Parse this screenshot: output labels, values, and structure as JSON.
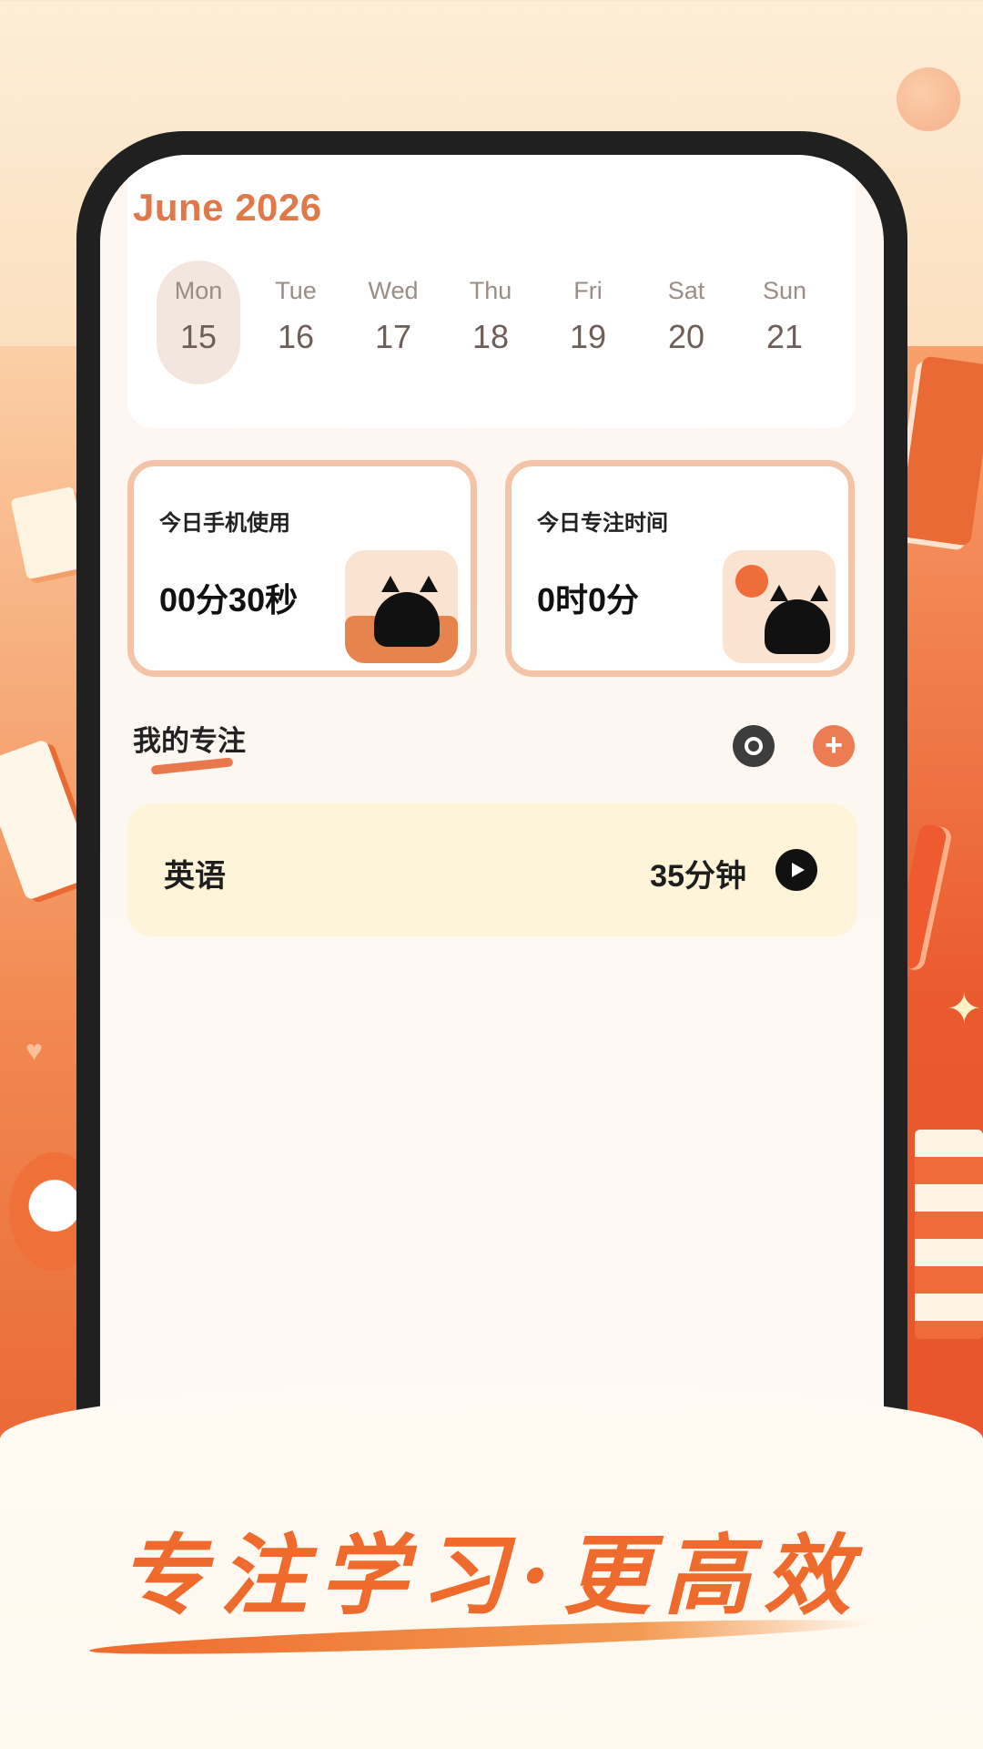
{
  "calendar": {
    "month_label": "June 2026",
    "days": [
      {
        "name": "Mon",
        "date": "15",
        "selected": true
      },
      {
        "name": "Tue",
        "date": "16"
      },
      {
        "name": "Wed",
        "date": "17"
      },
      {
        "name": "Thu",
        "date": "18"
      },
      {
        "name": "Fri",
        "date": "19"
      },
      {
        "name": "Sat",
        "date": "20"
      },
      {
        "name": "Sun",
        "date": "21"
      }
    ]
  },
  "stats": {
    "phone_usage": {
      "title": "今日手机使用",
      "value": "00分30秒"
    },
    "focus_time": {
      "title": "今日专注时间",
      "value": "0时0分"
    }
  },
  "my_focus": {
    "title": "我的专注",
    "items": [
      {
        "name": "英语",
        "duration": "35分钟"
      }
    ]
  },
  "banner": {
    "slogan": "专注学习·更高效"
  },
  "colors": {
    "accent": "#e0784a",
    "slogan": "#ee6a2d",
    "item_bg": "#fdf4d9",
    "card_border": "#f3c4a8"
  },
  "icons": {
    "settings": "settings-icon",
    "add": "plus-icon",
    "play": "play-icon"
  }
}
